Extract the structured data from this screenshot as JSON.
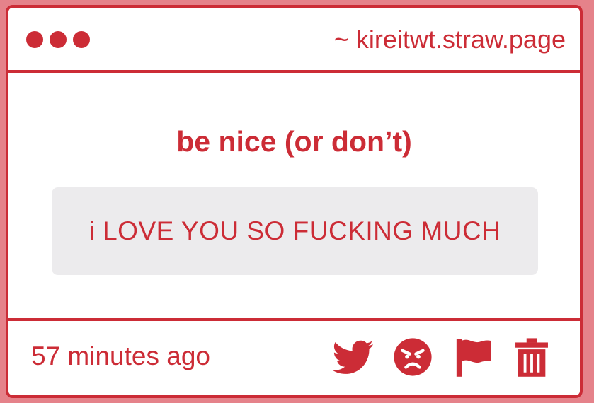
{
  "header": {
    "dots": [
      "window-dot",
      "window-dot",
      "window-dot"
    ],
    "site": "~ kireitwt.straw.page"
  },
  "main": {
    "title": "be nice (or don’t)",
    "message": "i LOVE YOU SO FUCKING MUCH"
  },
  "footer": {
    "timestamp": "57 minutes ago",
    "actions": [
      {
        "icon": "twitter-icon"
      },
      {
        "icon": "angry-face-icon"
      },
      {
        "icon": "flag-icon"
      },
      {
        "icon": "trash-icon"
      }
    ]
  },
  "colors": {
    "accent": "#cc2c36",
    "message_bg": "#ecebed",
    "outer_bg": "#e5828a"
  }
}
